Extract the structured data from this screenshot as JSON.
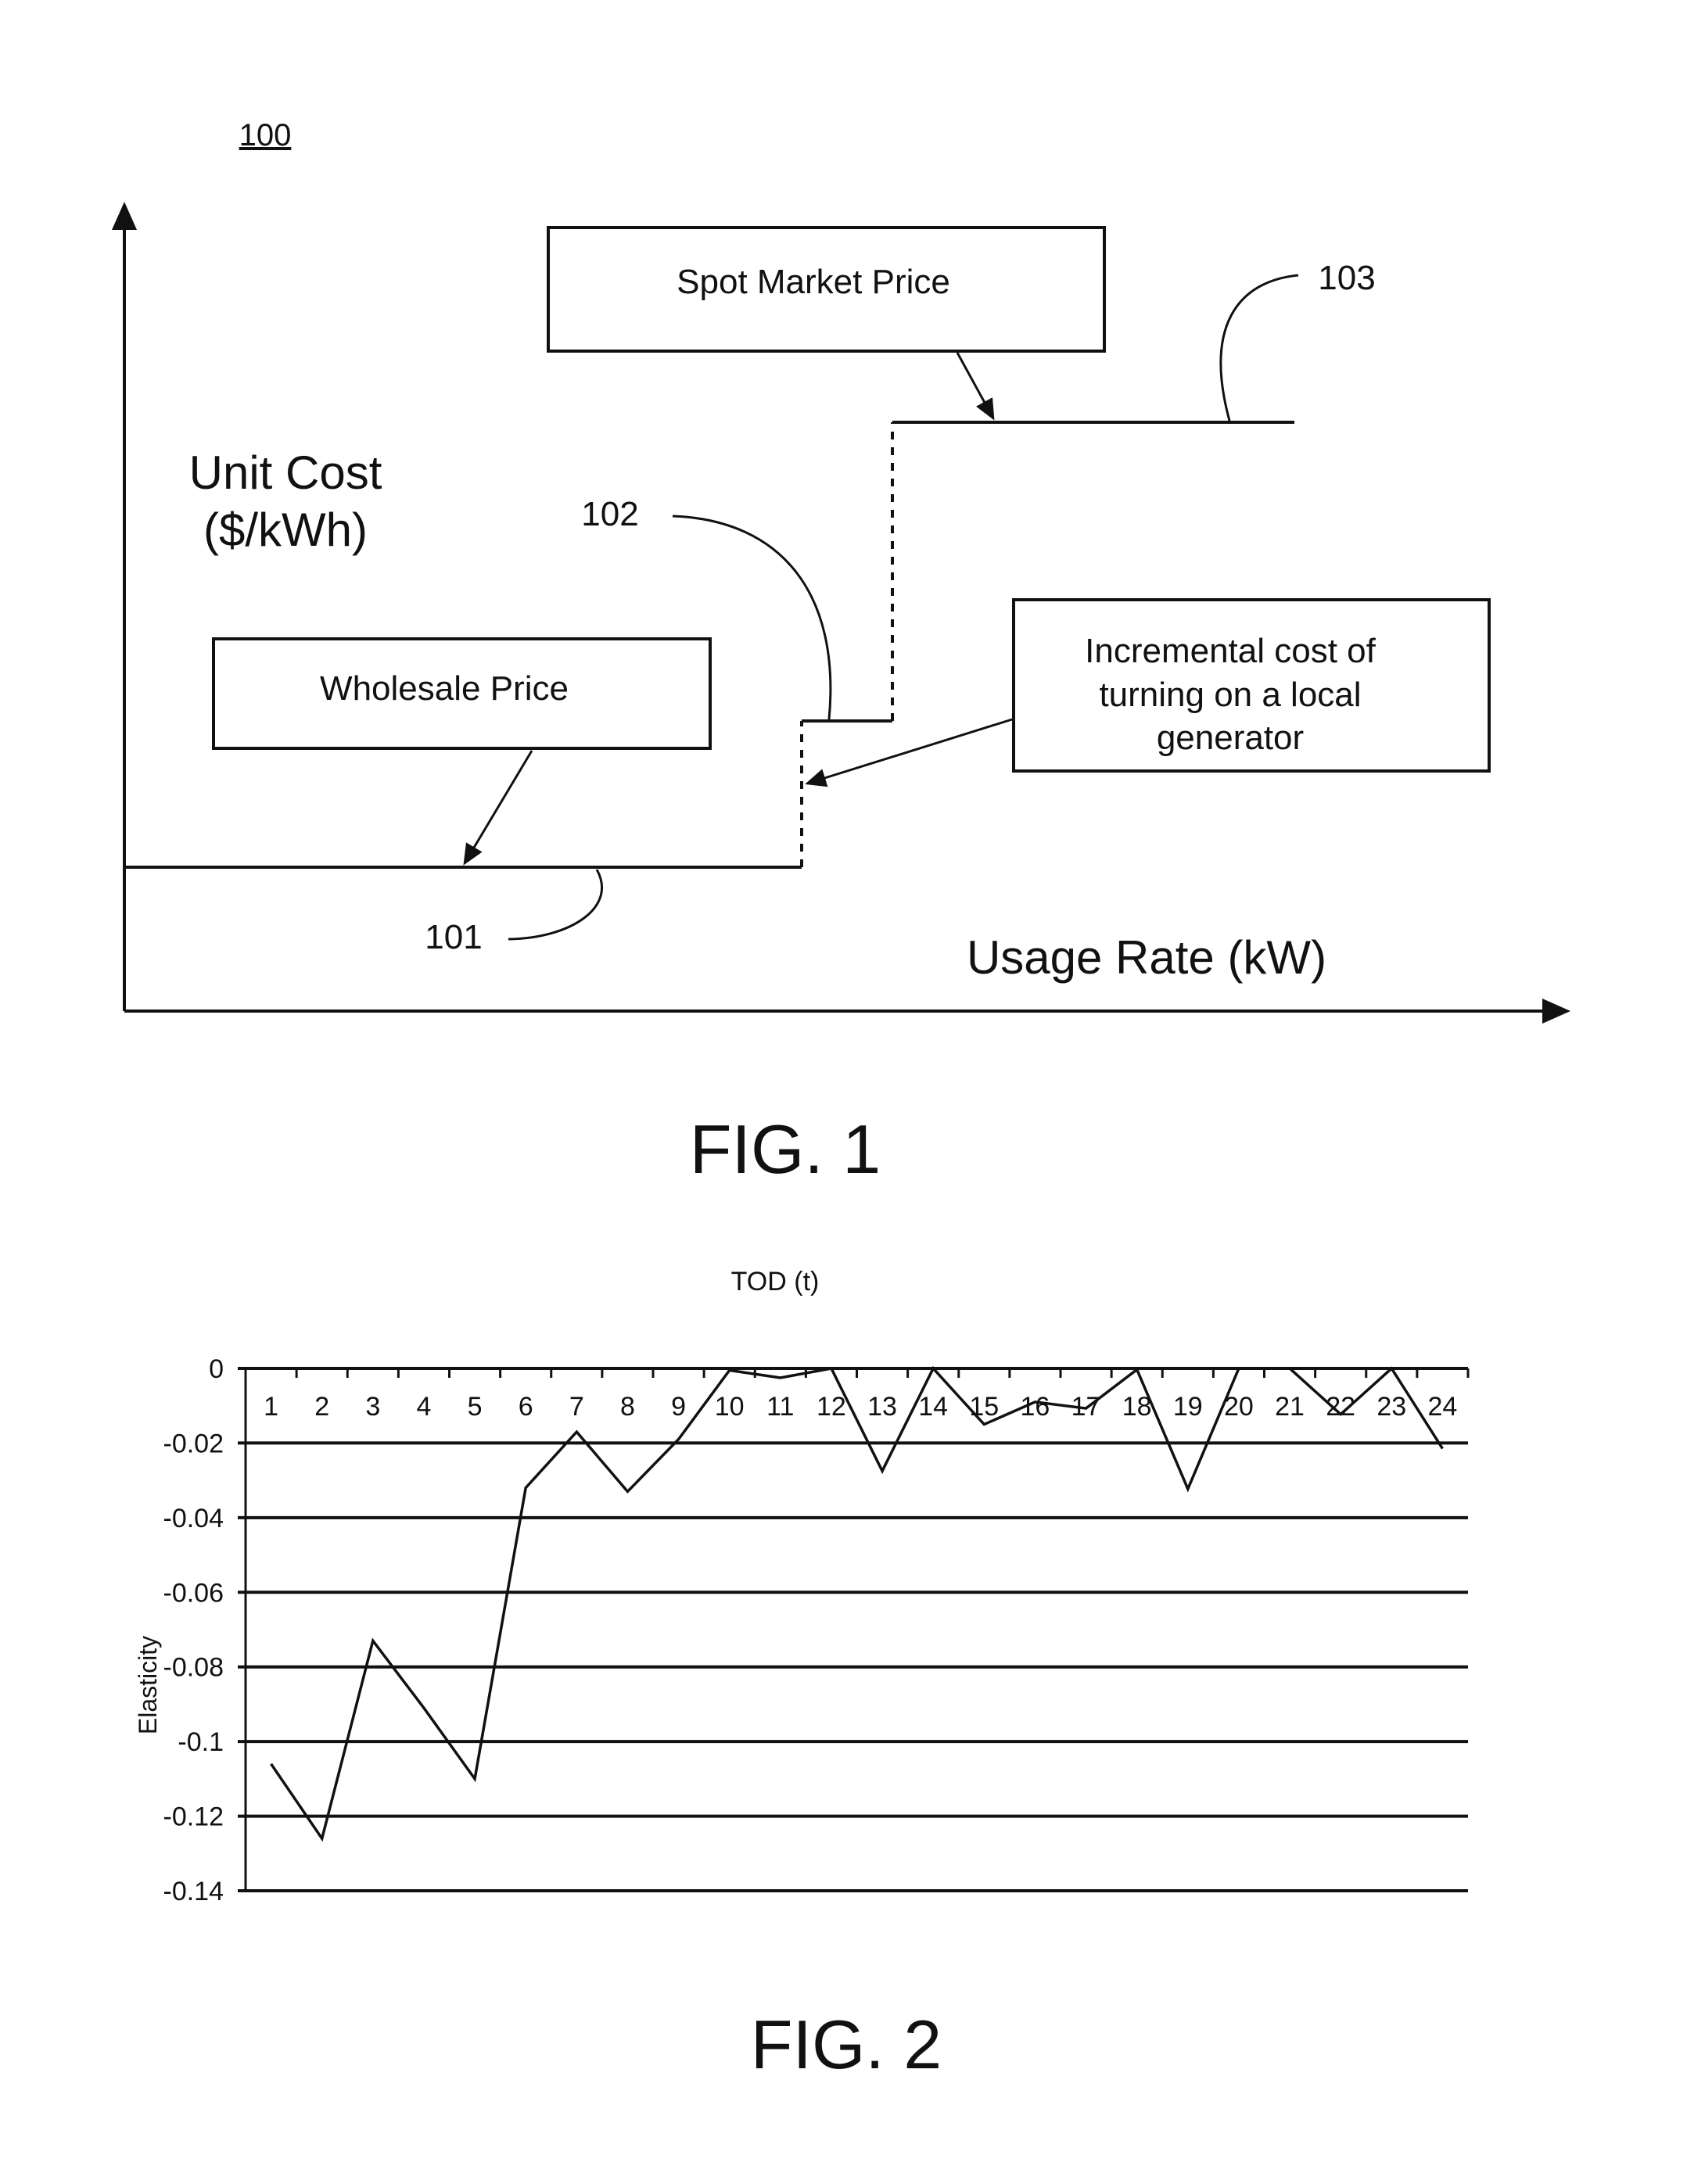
{
  "page": {
    "ref_numeral_figure": "100"
  },
  "fig1": {
    "caption": "FIG. 1",
    "y_axis_label_line1": "Unit Cost",
    "y_axis_label_line2": "($/kWh)",
    "x_axis_label": "Usage Rate (kW)",
    "boxes": {
      "spot_market": "Spot Market Price",
      "wholesale": "Wholesale Price",
      "incremental_line1": "Incremental cost of",
      "incremental_line2": "turning on a local",
      "incremental_line3": "generator"
    },
    "ref_labels": {
      "wholesale_segment": "101",
      "generator_segment": "102",
      "spot_segment": "103"
    }
  },
  "fig2": {
    "caption": "FIG. 2"
  },
  "chart_data": {
    "type": "line",
    "title": "TOD (t)",
    "xlabel": "TOD (t)",
    "ylabel": "Elasticity",
    "categories": [
      "1",
      "2",
      "3",
      "4",
      "5",
      "6",
      "7",
      "8",
      "9",
      "10",
      "11",
      "12",
      "13",
      "14",
      "15",
      "16",
      "17",
      "18",
      "19",
      "20",
      "21",
      "22",
      "23",
      "24"
    ],
    "series": [
      {
        "name": "Elasticity",
        "values": [
          -0.106,
          -0.126,
          -0.073,
          -0.091,
          -0.11,
          -0.032,
          -0.017,
          -0.033,
          -0.019,
          -0.0005,
          -0.0025,
          0.0,
          -0.0275,
          0.0,
          -0.015,
          -0.009,
          -0.0107,
          -0.0003,
          -0.0323,
          0.0,
          0.0,
          -0.0123,
          0.0,
          -0.0215
        ]
      }
    ],
    "ylim": [
      -0.14,
      0
    ],
    "yticks": [
      "0",
      "-0.02",
      "-0.04",
      "-0.06",
      "-0.08",
      "-0.1",
      "-0.12",
      "-0.14"
    ],
    "ytick_values": [
      0,
      -0.02,
      -0.04,
      -0.06,
      -0.08,
      -0.1,
      -0.12,
      -0.14
    ],
    "x_axis_position": "top",
    "grid": true,
    "legend": "none"
  }
}
